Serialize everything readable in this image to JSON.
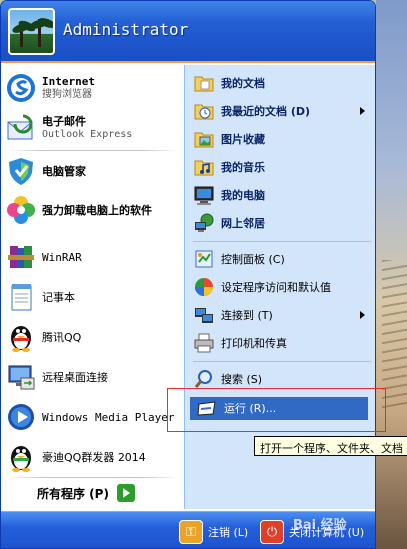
{
  "user": {
    "name": "Administrator"
  },
  "pinned": [
    {
      "title": "Internet",
      "subtitle": "搜狗浏览器",
      "icon": "sogou-browser-icon"
    },
    {
      "title": "电子邮件",
      "subtitle": "Outlook Express",
      "icon": "outlook-express-icon"
    }
  ],
  "programs": [
    {
      "label": "电脑管家",
      "icon": "pc-manager-shield-icon",
      "bold": true
    },
    {
      "label": "强力卸载电脑上的软件",
      "icon": "uninstaller-flower-icon",
      "bold": true
    },
    {
      "label": "WinRAR",
      "icon": "winrar-books-icon",
      "bold": false
    },
    {
      "label": "记事本",
      "icon": "notepad-icon",
      "bold": false
    },
    {
      "label": "腾讯QQ",
      "icon": "qq-penguin-icon",
      "bold": false
    },
    {
      "label": "远程桌面连接",
      "icon": "remote-desktop-icon",
      "bold": false
    },
    {
      "label": "Windows Media Player",
      "icon": "windows-media-player-icon",
      "bold": false
    },
    {
      "label": "豪迪QQ群发器 2014",
      "icon": "qq-sender-penguin-icon",
      "bold": false
    }
  ],
  "all_programs": {
    "label": "所有程序 (P)"
  },
  "right": {
    "my_documents": "我的文档",
    "recent_documents": "我最近的文档 (D)",
    "my_pictures": "图片收藏",
    "my_music": "我的音乐",
    "my_computer": "我的电脑",
    "network_places": "网上邻居",
    "control_panel": "控制面板 (C)",
    "set_program_access": "设定程序访问和默认值",
    "connect_to": "连接到 (T)",
    "printers_faxes": "打印机和传真",
    "search": "搜索 (S)",
    "run": "运行 (R)..."
  },
  "tooltip": {
    "text": "打开一个程序、文件夹、文档"
  },
  "footer": {
    "logoff": "注销 (L)",
    "shutdown": "关闭计算机 (U)"
  },
  "watermark": "Bai 经验",
  "colors": {
    "header_blue": "#2460d4",
    "highlight_blue": "#316ac5",
    "right_panel": "#d3e5fa",
    "accent_orange": "#f49a3f"
  }
}
